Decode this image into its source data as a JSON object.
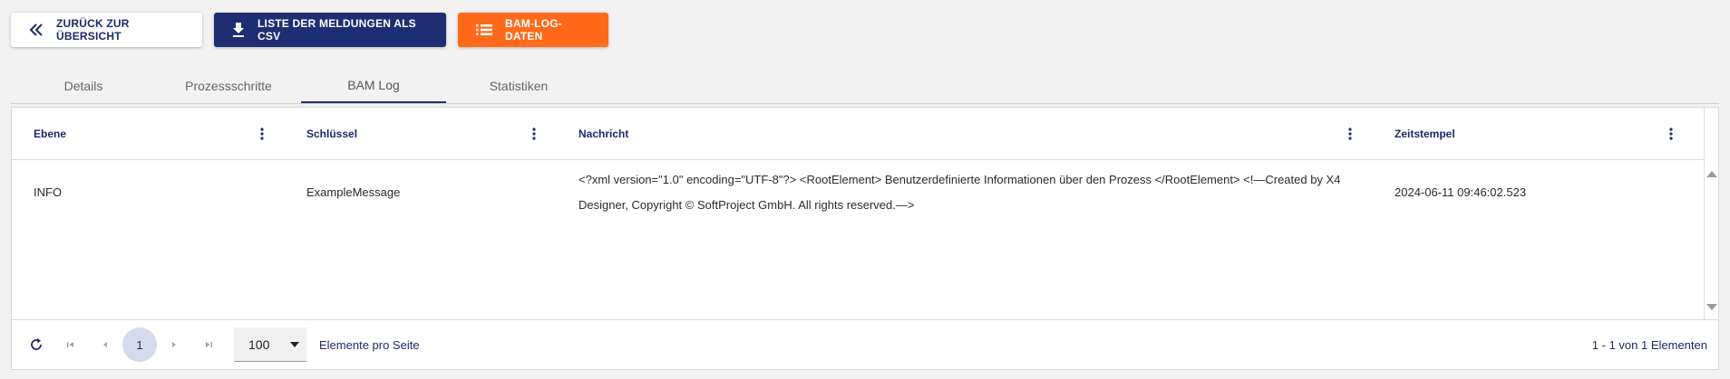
{
  "toolbar": {
    "back_label": "ZURÜCK ZUR ÜBERSICHT",
    "csv_label": "LISTE DER MELDUNGEN ALS CSV",
    "bam_label": "BAM-LOG-DATEN",
    "icons": {
      "back": "double-chevron-left-icon",
      "csv": "download-icon",
      "bam": "list-icon"
    },
    "colors": {
      "navy": "#1f2e72",
      "orange": "#ff6a1a"
    }
  },
  "tabs": [
    {
      "label": "Details",
      "active": false
    },
    {
      "label": "Prozessschritte",
      "active": false
    },
    {
      "label": "BAM Log",
      "active": true
    },
    {
      "label": "Statistiken",
      "active": false
    }
  ],
  "table": {
    "columns": [
      "Ebene",
      "Schlüssel",
      "Nachricht",
      "Zeitstempel"
    ],
    "rows": [
      {
        "ebene": "INFO",
        "schluessel": "ExampleMessage",
        "nachricht": "<?xml version=\"1.0\" encoding=\"UTF-8\"?> <RootElement> Benutzerdefinierte Informationen über den Prozess </RootElement> <!—Created by X4 Designer, Copyright © SoftProject GmbH. All rights reserved.—>",
        "zeitstempel": "2024-06-11 09:46:02.523"
      }
    ]
  },
  "pagination": {
    "current_page": "1",
    "page_size": "100",
    "per_page_label": "Elemente pro Seite",
    "range_label": "1 - 1 von 1 Elementen"
  }
}
